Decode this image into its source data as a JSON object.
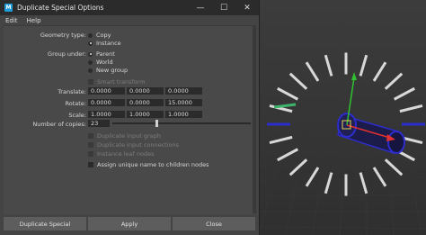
{
  "window": {
    "title": "Duplicate Special Options",
    "minimize": "—",
    "maximize": "☐",
    "close": "✕"
  },
  "menu": [
    "Edit",
    "Help"
  ],
  "geometry_type": {
    "label": "Geometry type:",
    "options": [
      "Copy",
      "Instance"
    ],
    "selected": "Instance"
  },
  "group_under": {
    "label": "Group under:",
    "options": [
      "Parent",
      "World",
      "New group"
    ],
    "selected": "Parent"
  },
  "smart_transform": {
    "label": "Smart transform",
    "checked": false,
    "enabled": false
  },
  "translate": {
    "label": "Translate:",
    "values": [
      "0.0000",
      "0.0000",
      "0.0000"
    ]
  },
  "rotate": {
    "label": "Rotate:",
    "values": [
      "0.0000",
      "0.0000",
      "15.0000"
    ]
  },
  "scale": {
    "label": "Scale:",
    "values": [
      "1.0000",
      "1.0000",
      "1.0000"
    ]
  },
  "copies": {
    "label": "Number of copies:",
    "value": "23"
  },
  "options": [
    {
      "label": "Duplicate input graph",
      "enabled": false
    },
    {
      "label": "Duplicate input connections",
      "enabled": false
    },
    {
      "label": "Instance leaf nodes",
      "enabled": false
    },
    {
      "label": "Assign unique name to children nodes",
      "enabled": true
    }
  ],
  "buttons": {
    "duplicate": "Duplicate Special",
    "apply": "Apply",
    "close": "Close"
  },
  "colors": {
    "accent": "#1f9bd7",
    "selection": "#2d2dcc",
    "axis_x": "#e03030",
    "axis_y": "#30c030"
  }
}
